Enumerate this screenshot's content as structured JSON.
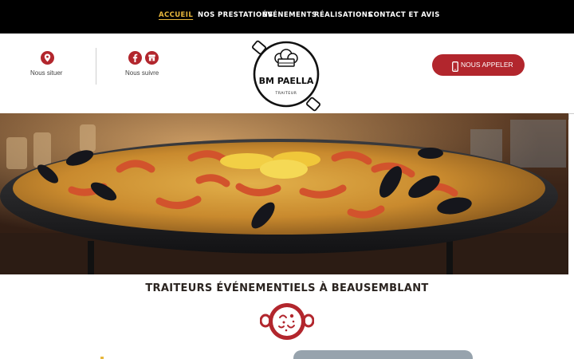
{
  "nav": {
    "items": [
      {
        "label": "ACCUEIL",
        "active": true
      },
      {
        "label": "NOS PRESTATIONS",
        "active": false
      },
      {
        "label": "ÉVÉNEMENTS",
        "active": false
      },
      {
        "label": "RÉALISATIONS",
        "active": false
      },
      {
        "label": "CONTACT ET AVIS",
        "active": false
      }
    ]
  },
  "header": {
    "locate": {
      "label": "Nous situer",
      "icon": "location-pin-icon"
    },
    "follow": {
      "label": "Nous suivre",
      "icons": [
        "facebook-icon",
        "storefront-icon"
      ]
    },
    "logo": {
      "name": "BM PAELLA",
      "tagline": "TRAITEUR"
    },
    "call_button": {
      "label": "NOUS APPELER",
      "icon": "smartphone-icon"
    }
  },
  "main": {
    "heading": "TRAITEURS ÉVÉNEMENTIELS À BEAUSEMBLANT"
  },
  "colors": {
    "brand_red": "#b2262d",
    "nav_bg": "#000000",
    "nav_active": "#e7b73c"
  }
}
